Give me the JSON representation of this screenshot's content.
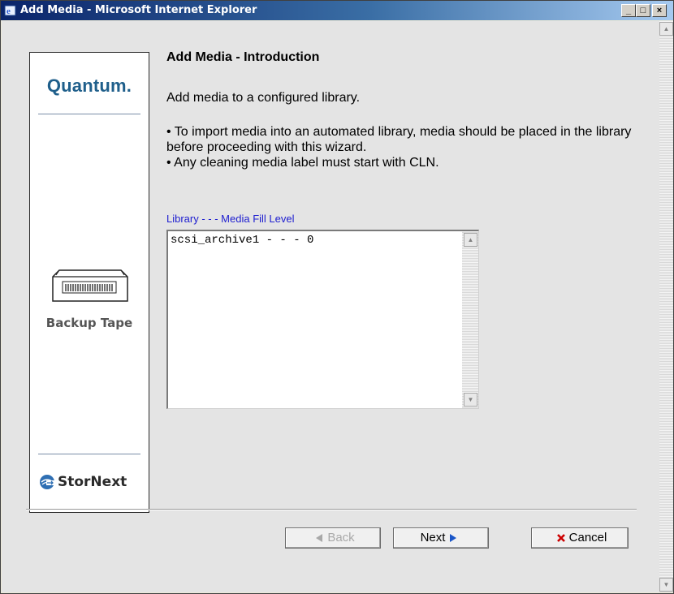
{
  "window": {
    "title": "Add Media - Microsoft Internet Explorer",
    "minimize_glyph": "_",
    "maximize_glyph": "□",
    "close_glyph": "×"
  },
  "sidebar": {
    "brand": "Quantum.",
    "illustration_caption": "Backup Tape",
    "product": "StorNext"
  },
  "main": {
    "heading": "Add Media - Introduction",
    "intro": "Add media to a configured library.",
    "bullets": [
      "• To import media into an automated library, media should be placed in the library before proceeding with this wizard.",
      "• Any cleaning media label must start with CLN."
    ],
    "list_label": "Library - - - Media Fill Level",
    "list_items": [
      "scsi_archive1 - - - 0"
    ]
  },
  "buttons": {
    "back": "Back",
    "next": "Next",
    "cancel": "Cancel"
  },
  "colors": {
    "accent_blue": "#2020d0",
    "brand_blue": "#1f5f8b",
    "cancel_red": "#cc0000",
    "next_blue": "#1a56c8"
  }
}
